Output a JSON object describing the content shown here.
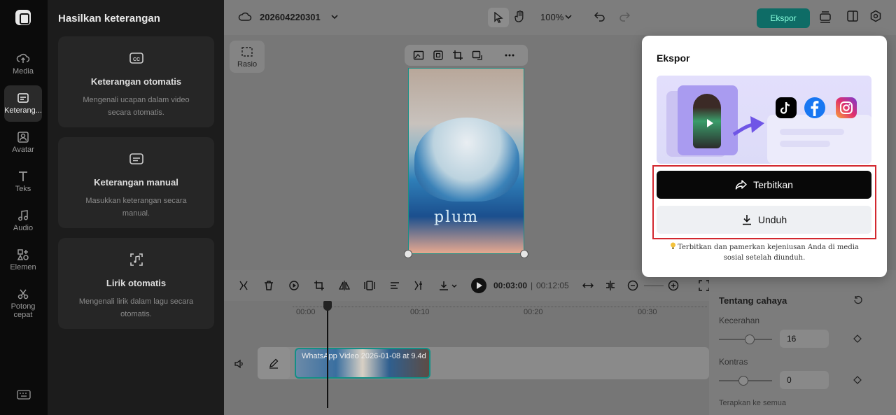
{
  "rail": {
    "items": [
      {
        "label": "Media",
        "icon": "cloud-upload-icon"
      },
      {
        "label": "Keterang...",
        "icon": "captions-icon"
      },
      {
        "label": "Avatar",
        "icon": "avatar-icon"
      },
      {
        "label": "Teks",
        "icon": "text-icon"
      },
      {
        "label": "Audio",
        "icon": "music-note-icon"
      },
      {
        "label": "Elemen",
        "icon": "elements-icon"
      },
      {
        "label": "Potong cepat",
        "icon": "scissors-icon"
      }
    ]
  },
  "panel": {
    "title": "Hasilkan keterangan",
    "cards": [
      {
        "title": "Keterangan otomatis",
        "desc": "Mengenali ucapan dalam video secara otomatis."
      },
      {
        "title": "Keterangan manual",
        "desc": "Masukkan keterangan secara manual."
      },
      {
        "title": "Lirik otomatis",
        "desc": "Mengenali lirik dalam lagu secara otomatis."
      }
    ]
  },
  "topbar": {
    "project_name": "202604220301",
    "zoom": "100%",
    "export_label": "Ekspor"
  },
  "canvas": {
    "ratio_label": "Rasio",
    "video_brand": "plum"
  },
  "timeline": {
    "current_time": "00:03:00",
    "total_time": "00:12:05",
    "ticks": [
      "00:00",
      "00:10",
      "00:20",
      "00:30"
    ],
    "clip_name": "WhatsApp Video 2026-01-08 at 9.4d"
  },
  "adjust": {
    "section_title": "Tentang cahaya",
    "brightness_label": "Kecerahan",
    "brightness_value": "16",
    "brightness_fraction": 0.6,
    "contrast_label": "Kontras",
    "contrast_value": "0",
    "contrast_fraction": 0.45,
    "apply_all": "Terapkan ke semua"
  },
  "export": {
    "title": "Ekspor",
    "publish_label": "Terbitkan",
    "download_label": "Unduh",
    "tip": "Terbitkan dan pamerkan kejeniusan Anda di media sosial setelah diunduh.",
    "social_icons": [
      "tiktok-icon",
      "facebook-icon",
      "instagram-icon"
    ],
    "colors": {
      "tiktok": "#000000",
      "facebook": "#1877f2",
      "instagram": "#e1306c"
    }
  }
}
